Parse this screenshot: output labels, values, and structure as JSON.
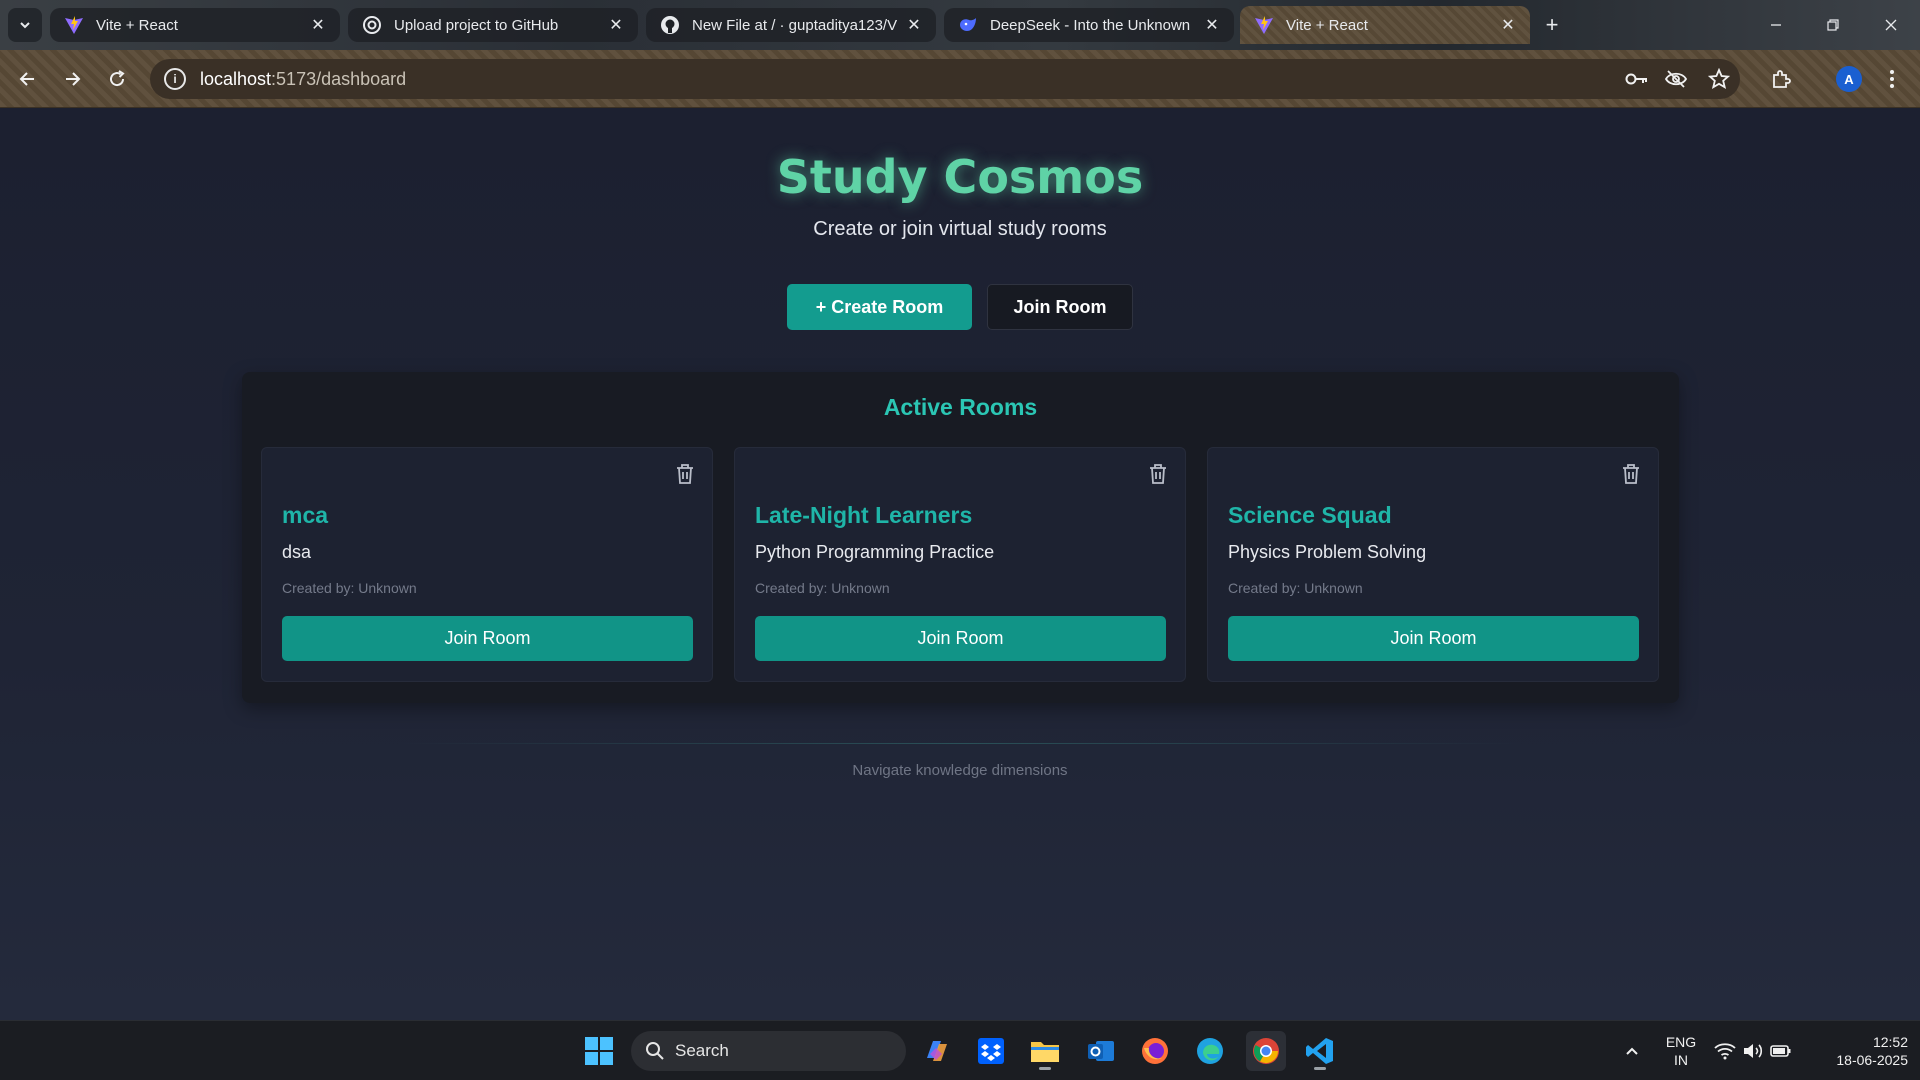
{
  "browser": {
    "tabs": [
      {
        "title": "Vite + React",
        "favicon": "vite-icon",
        "active": false
      },
      {
        "title": "Upload project to GitHub",
        "favicon": "openai-icon",
        "active": false
      },
      {
        "title": "New File at / · guptaditya123/V",
        "favicon": "github-icon",
        "active": false
      },
      {
        "title": "DeepSeek - Into the Unknown",
        "favicon": "deepseek-icon",
        "active": false
      },
      {
        "title": "Vite + React",
        "favicon": "vite-icon",
        "active": true
      }
    ],
    "url_host": "localhost",
    "url_path": ":5173/dashboard",
    "profile_initial": "A"
  },
  "app": {
    "title": "Study Cosmos",
    "subtitle": "Create or join virtual study rooms",
    "create_room_label": "+  Create Room",
    "join_room_label": "Join Room",
    "rooms_heading": "Active Rooms",
    "footer": "Navigate knowledge dimensions",
    "accent_color": "#139c8f"
  },
  "rooms": [
    {
      "name": "mca",
      "description": "dsa",
      "creator": "Created by: Unknown",
      "join_label": "Join Room"
    },
    {
      "name": "Late-Night Learners",
      "description": "Python Programming Practice",
      "creator": "Created by: Unknown",
      "join_label": "Join Room"
    },
    {
      "name": "Science Squad",
      "description": "Physics Problem Solving",
      "creator": "Created by: Unknown",
      "join_label": "Join Room"
    }
  ],
  "taskbar": {
    "search_label": "Search",
    "lang_line1": "ENG",
    "lang_line2": "IN",
    "time": "12:52",
    "date": "18-06-2025"
  }
}
